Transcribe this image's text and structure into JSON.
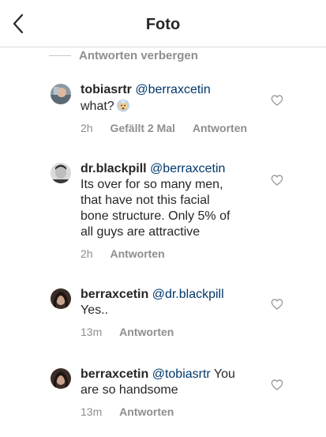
{
  "header": {
    "title": "Foto"
  },
  "hide_replies_label": "Antworten verbergen",
  "comments": [
    {
      "username": "tobiasrtr",
      "mention": "@berraxcetin",
      "text_lines": [
        "what?"
      ],
      "time": "2h",
      "likes": "Gefällt 2 Mal",
      "reply": "Antworten"
    },
    {
      "username": "dr.blackpill",
      "mention": "@berraxcetin",
      "text_lines": [
        "Its over for so many men,",
        "that have not this facial",
        "bone structure. Only 5% of",
        "all guys are attractive"
      ],
      "time": "2h",
      "reply": "Antworten"
    },
    {
      "username": "berraxcetin",
      "mention": "@dr.blackpill",
      "text_lines": [
        "Yes.."
      ],
      "time": "13m",
      "reply": "Antworten"
    },
    {
      "username": "berraxcetin",
      "mention": "@tobiasrtr",
      "after_mention": " You",
      "text_lines": [
        "are so handsome"
      ],
      "time": "13m",
      "reply": "Antworten"
    }
  ],
  "icons": {
    "back": "chevron-left-icon",
    "like": "heart-outline-icon",
    "emoji": "old-woman-emoji"
  },
  "colors": {
    "text": "#262626",
    "mention": "#00376b",
    "secondary": "#8e8e8e",
    "divider": "#dbdbdb"
  }
}
